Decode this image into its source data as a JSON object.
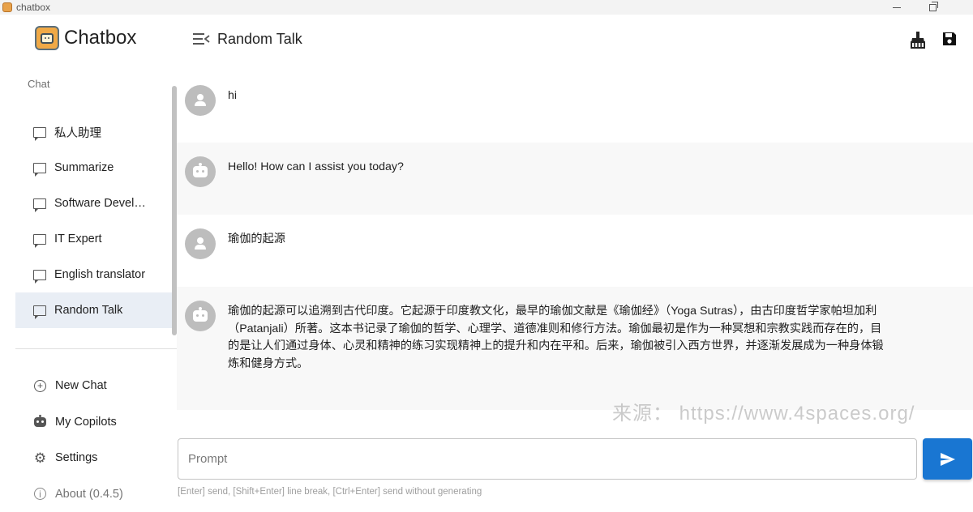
{
  "window": {
    "title": "chatbox"
  },
  "brand": {
    "name": "Chatbox"
  },
  "sidebar": {
    "section_label": "Chat",
    "sessions": [
      {
        "label": "私人助理",
        "active": false
      },
      {
        "label": "Summarize",
        "active": false
      },
      {
        "label": "Software Developer",
        "active": false
      },
      {
        "label": "IT Expert",
        "active": false
      },
      {
        "label": "English translator",
        "active": false
      },
      {
        "label": "Random Talk",
        "active": true
      }
    ],
    "menu": {
      "new_chat": "New Chat",
      "my_copilots": "My Copilots",
      "settings": "Settings",
      "about": "About (0.4.5)"
    }
  },
  "header": {
    "title": "Random Talk"
  },
  "messages": [
    {
      "role": "user",
      "text": "hi"
    },
    {
      "role": "assistant",
      "text": "Hello! How can I assist you today?"
    },
    {
      "role": "user",
      "text": "瑜伽的起源"
    },
    {
      "role": "assistant",
      "text": "瑜伽的起源可以追溯到古代印度。它起源于印度教文化，最早的瑜伽文献是《瑜伽经》（Yoga Sutras），由古印度哲学家帕坦加利（Patanjali）所著。这本书记录了瑜伽的哲学、心理学、道德准则和修行方法。瑜伽最初是作为一种冥想和宗教实践而存在的，目的是让人们通过身体、心灵和精神的练习实现精神上的提升和内在平和。后来，瑜伽被引入西方世界，并逐渐发展成为一种身体锻炼和健身方式。"
    }
  ],
  "watermark": "来源： https://www.4spaces.org/",
  "input": {
    "placeholder": "Prompt",
    "hint": "[Enter] send, [Shift+Enter] line break, [Ctrl+Enter] send without generating"
  },
  "colors": {
    "accent": "#1976d2",
    "active_session_bg": "#e9eef5",
    "avatar_bg": "#bdbdbd",
    "alt_message_bg": "#f8f8f8"
  }
}
